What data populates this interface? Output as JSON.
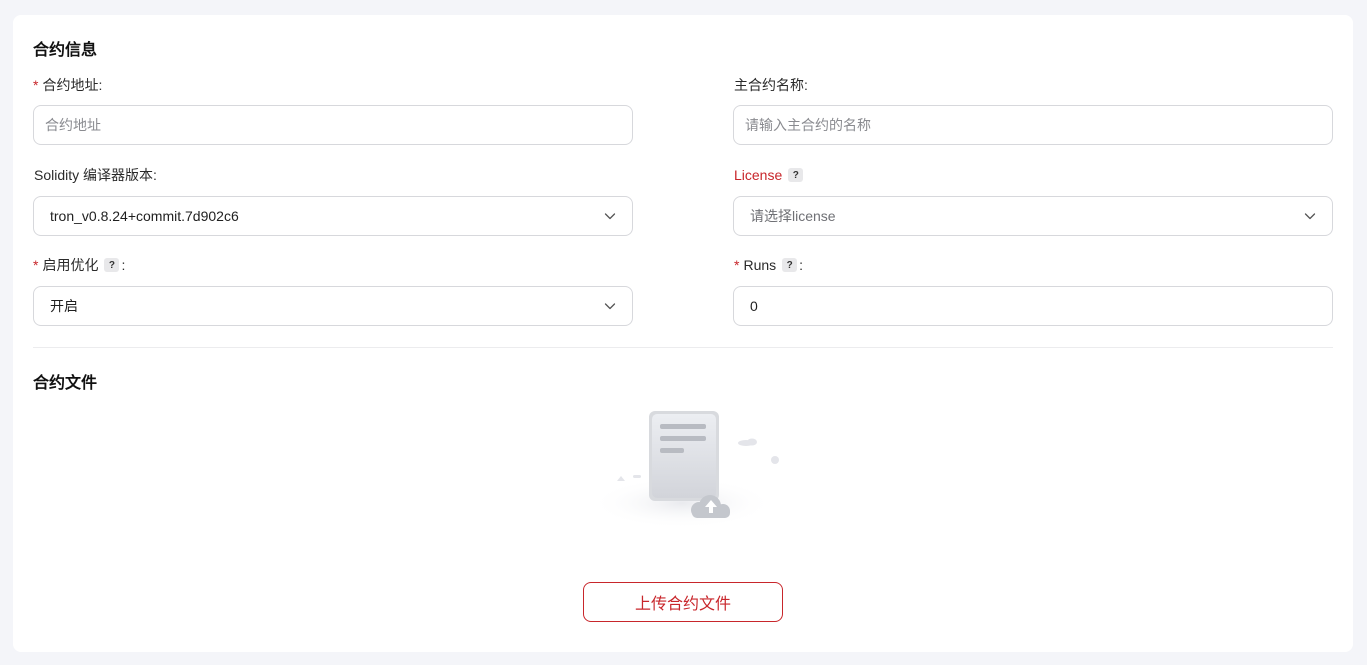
{
  "contract_info": {
    "title": "合约信息",
    "address": {
      "required_mark": "*",
      "label": "合约地址:",
      "placeholder": "合约地址",
      "value": ""
    },
    "main_contract_name": {
      "label": "主合约名称:",
      "placeholder": "请输入主合约的名称",
      "value": ""
    },
    "compiler_version": {
      "label": "Solidity 编译器版本:",
      "value": "tron_v0.8.24+commit.7d902c6"
    },
    "license": {
      "label": "License",
      "help": "?",
      "placeholder": "请选择license"
    },
    "optimization": {
      "required_mark": "*",
      "label": "启用优化",
      "help": "?",
      "colon": ":",
      "value": "开启"
    },
    "runs": {
      "required_mark": "*",
      "label": "Runs",
      "help": "?",
      "colon": ":",
      "value": "0"
    }
  },
  "contract_files": {
    "title": "合约文件",
    "illustration_icon": "document-upload-icon",
    "upload_button": "上传合约文件"
  },
  "colors": {
    "accent": "#c8262b",
    "background": "#f4f5f9",
    "card": "#ffffff",
    "border": "#d7d8dc"
  }
}
